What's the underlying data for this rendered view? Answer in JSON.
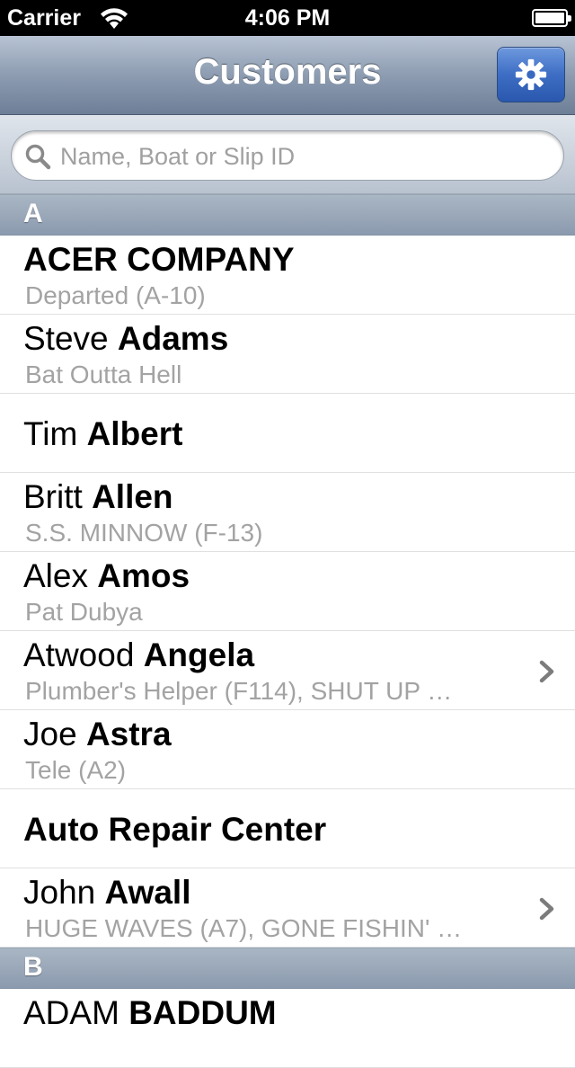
{
  "status_bar": {
    "carrier": "Carrier",
    "time": "4:06 PM"
  },
  "nav": {
    "title": "Customers",
    "settings_icon": "gear-icon"
  },
  "search": {
    "placeholder": "Name, Boat or Slip ID",
    "value": ""
  },
  "sections": [
    {
      "letter": "A",
      "rows": [
        {
          "first": "",
          "last": "ACER COMPANY",
          "detail": "Departed (A-10)",
          "chevron": false
        },
        {
          "first": "Steve ",
          "last": "Adams",
          "detail": "Bat Outta Hell",
          "chevron": false
        },
        {
          "first": "Tim ",
          "last": "Albert",
          "detail": "",
          "chevron": false
        },
        {
          "first": "Britt ",
          "last": "Allen",
          "detail": "S.S. MINNOW (F-13)",
          "chevron": false
        },
        {
          "first": "Alex ",
          "last": "Amos",
          "detail": "Pat Dubya",
          "chevron": false
        },
        {
          "first": "Atwood ",
          "last": "Angela",
          "detail": "Plumber's Helper (F114), SHUT UP …",
          "chevron": true
        },
        {
          "first": "Joe ",
          "last": "Astra",
          "detail": "Tele (A2)",
          "chevron": false
        },
        {
          "first": "",
          "last": "Auto Repair Center",
          "detail": "",
          "chevron": false
        },
        {
          "first": "John ",
          "last": "Awall",
          "detail": "HUGE WAVES (A7), GONE FISHIN' …",
          "chevron": true
        }
      ]
    },
    {
      "letter": "B",
      "rows": [
        {
          "first": "ADAM ",
          "last": "BADDUM",
          "detail": "",
          "chevron": false
        }
      ]
    }
  ]
}
